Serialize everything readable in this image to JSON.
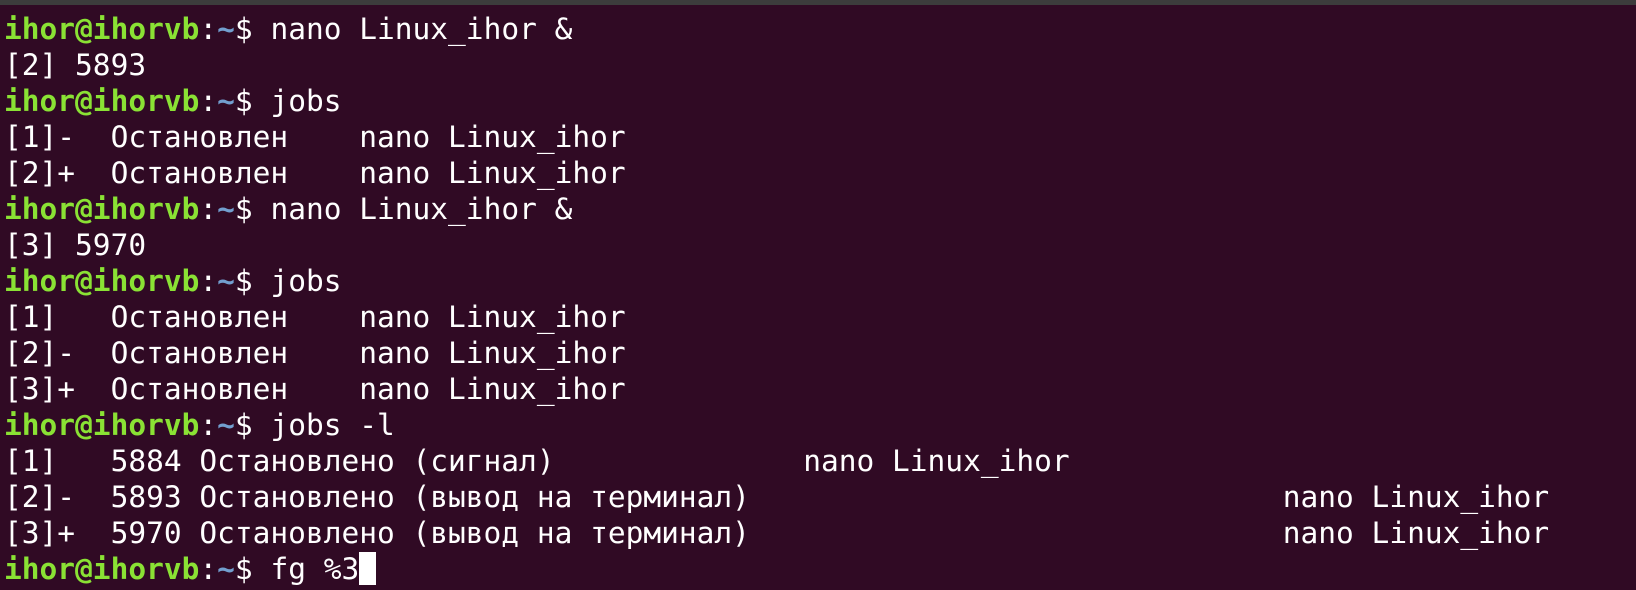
{
  "prompt": {
    "user_host": "ihor@ihorvb",
    "colon": ":",
    "path": "~",
    "dollar": "$ "
  },
  "lines": [
    {
      "type": "prompt",
      "cmd": "nano Linux_ihor &"
    },
    {
      "type": "output",
      "text": "[2] 5893"
    },
    {
      "type": "prompt",
      "cmd": "jobs"
    },
    {
      "type": "output",
      "text": "[1]-  Остановлен    nano Linux_ihor"
    },
    {
      "type": "output",
      "text": "[2]+  Остановлен    nano Linux_ihor"
    },
    {
      "type": "prompt",
      "cmd": "nano Linux_ihor &"
    },
    {
      "type": "output",
      "text": "[3] 5970"
    },
    {
      "type": "prompt",
      "cmd": "jobs"
    },
    {
      "type": "output",
      "text": "[1]   Остановлен    nano Linux_ihor"
    },
    {
      "type": "output",
      "text": "[2]-  Остановлен    nano Linux_ihor"
    },
    {
      "type": "output",
      "text": "[3]+  Остановлен    nano Linux_ihor"
    },
    {
      "type": "prompt",
      "cmd": "jobs -l"
    },
    {
      "type": "output",
      "text": "[1]   5884 Остановлено (сигнал)              nano Linux_ihor"
    },
    {
      "type": "output",
      "text": "[2]-  5893 Остановлено (вывод на терминал)                              nano Linux_ihor"
    },
    {
      "type": "output",
      "text": "[3]+  5970 Остановлено (вывод на терминал)                              nano Linux_ihor"
    },
    {
      "type": "prompt",
      "cmd": "fg %3",
      "cursor": true
    }
  ],
  "colors": {
    "background": "#300a24",
    "user_host": "#8ae234",
    "path": "#729fcf",
    "text": "#ffffff"
  }
}
